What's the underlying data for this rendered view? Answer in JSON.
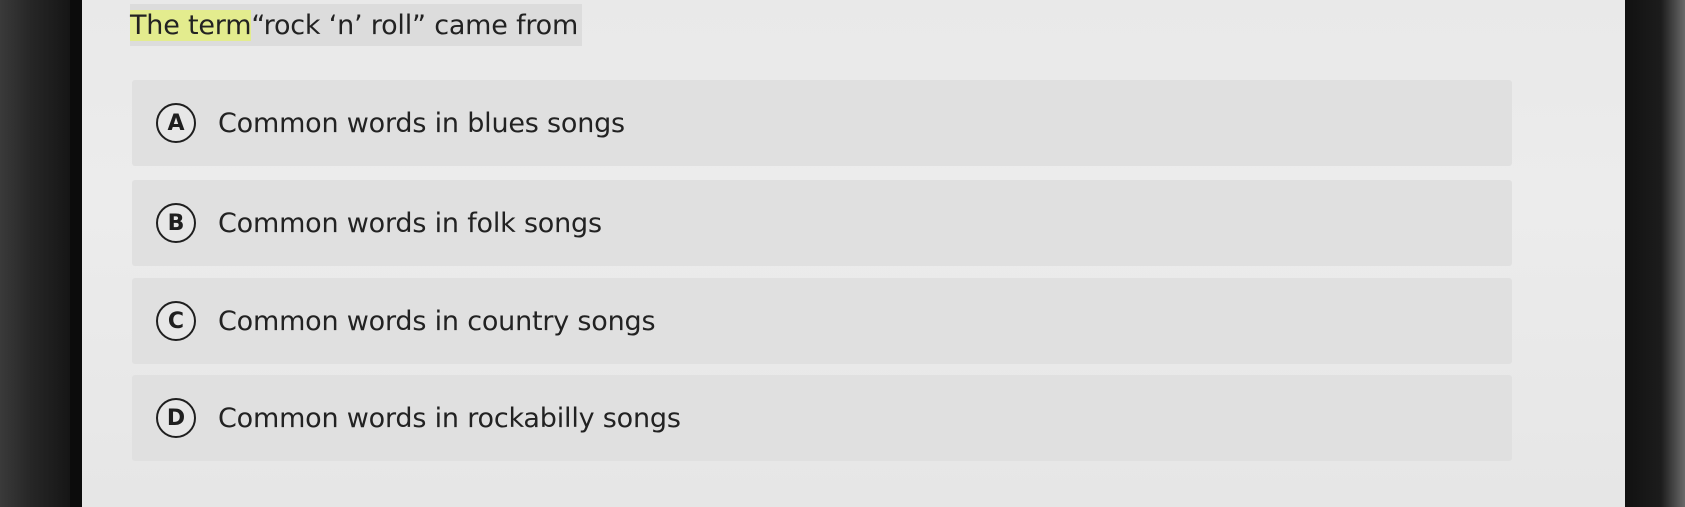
{
  "question": {
    "highlighted": "The term",
    "rest": " “rock ‘n’ roll” came from"
  },
  "options": [
    {
      "letter": "A",
      "text": "Common words in blues songs"
    },
    {
      "letter": "B",
      "text": "Common words in folk songs"
    },
    {
      "letter": "C",
      "text": "Common words in country songs"
    },
    {
      "letter": "D",
      "text": "Common words in rockabilly songs"
    }
  ],
  "colors": {
    "highlight": "#e3ec8e",
    "option_bg": "#e0e0e0",
    "screen_bg": "#e9e9e9"
  }
}
